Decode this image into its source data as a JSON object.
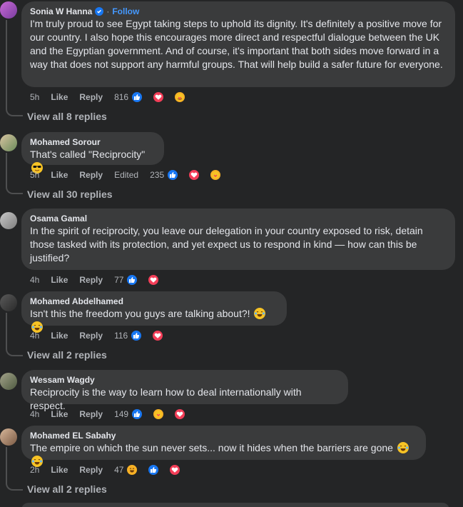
{
  "comments": [
    {
      "author": "Sonia W Hanna",
      "verified": true,
      "follow_label": "Follow",
      "text": "I'm truly proud to see Egypt taking steps to uphold its dignity. It's definitely a positive move for our country. I also hope this encourages more direct and respectful dialogue between the UK and the Egyptian government. And of course, it's important that both sides move forward in a way that does not support any harmful groups. That will help build a safer future for everyone.",
      "time": "5h",
      "like_label": "Like",
      "reply_label": "Reply",
      "reaction_count": "816",
      "reactions": [
        "like-icon",
        "love-icon",
        "care-icon"
      ],
      "view_replies": "View all 8 replies"
    },
    {
      "author": "Mohamed Sorour",
      "text": "That's called \"Reciprocity\"",
      "time": "5h",
      "like_label": "Like",
      "reply_label": "Reply",
      "edited_label": "Edited",
      "reaction_count": "235",
      "reactions": [
        "like-icon",
        "love-icon",
        "care-icon"
      ],
      "view_replies": "View all 30 replies"
    },
    {
      "author": "Osama Gamal",
      "text": "In the spirit of reciprocity, you leave our delegation in your country exposed to risk, detain those tasked with its protection, and yet expect us to respond in kind — how can this be justified?",
      "time": "4h",
      "like_label": "Like",
      "reply_label": "Reply",
      "reaction_count": "77",
      "reactions": [
        "like-icon",
        "love-icon"
      ]
    },
    {
      "author": "Mohamed Abdelhamed",
      "text": "Isn't this the freedom you guys are talking about?!",
      "time": "4h",
      "like_label": "Like",
      "reply_label": "Reply",
      "reaction_count": "116",
      "reactions": [
        "like-icon",
        "love-icon"
      ],
      "view_replies": "View all 2 replies"
    },
    {
      "author": "Wessam Wagdy",
      "text": "Reciprocity is the way to learn how to deal internationally with respect.",
      "time": "4h",
      "like_label": "Like",
      "reply_label": "Reply",
      "reaction_count": "149",
      "reactions": [
        "like-icon",
        "care-icon",
        "love-icon"
      ]
    },
    {
      "author": "Mohamed EL Sabahy",
      "text": "The empire on which the sun never sets... now it hides when the barriers are gone",
      "time": "2h",
      "like_label": "Like",
      "reply_label": "Reply",
      "reaction_count": "47",
      "reactions": [
        "haha-icon",
        "like-icon",
        "love-icon"
      ],
      "view_replies": "View all 2 replies"
    }
  ],
  "colors": {
    "background": "#242526",
    "bubble": "#3a3b3c",
    "like": "#1877f2",
    "love": "#f33e58",
    "care": "#f7b125",
    "follow": "#4599ff"
  }
}
